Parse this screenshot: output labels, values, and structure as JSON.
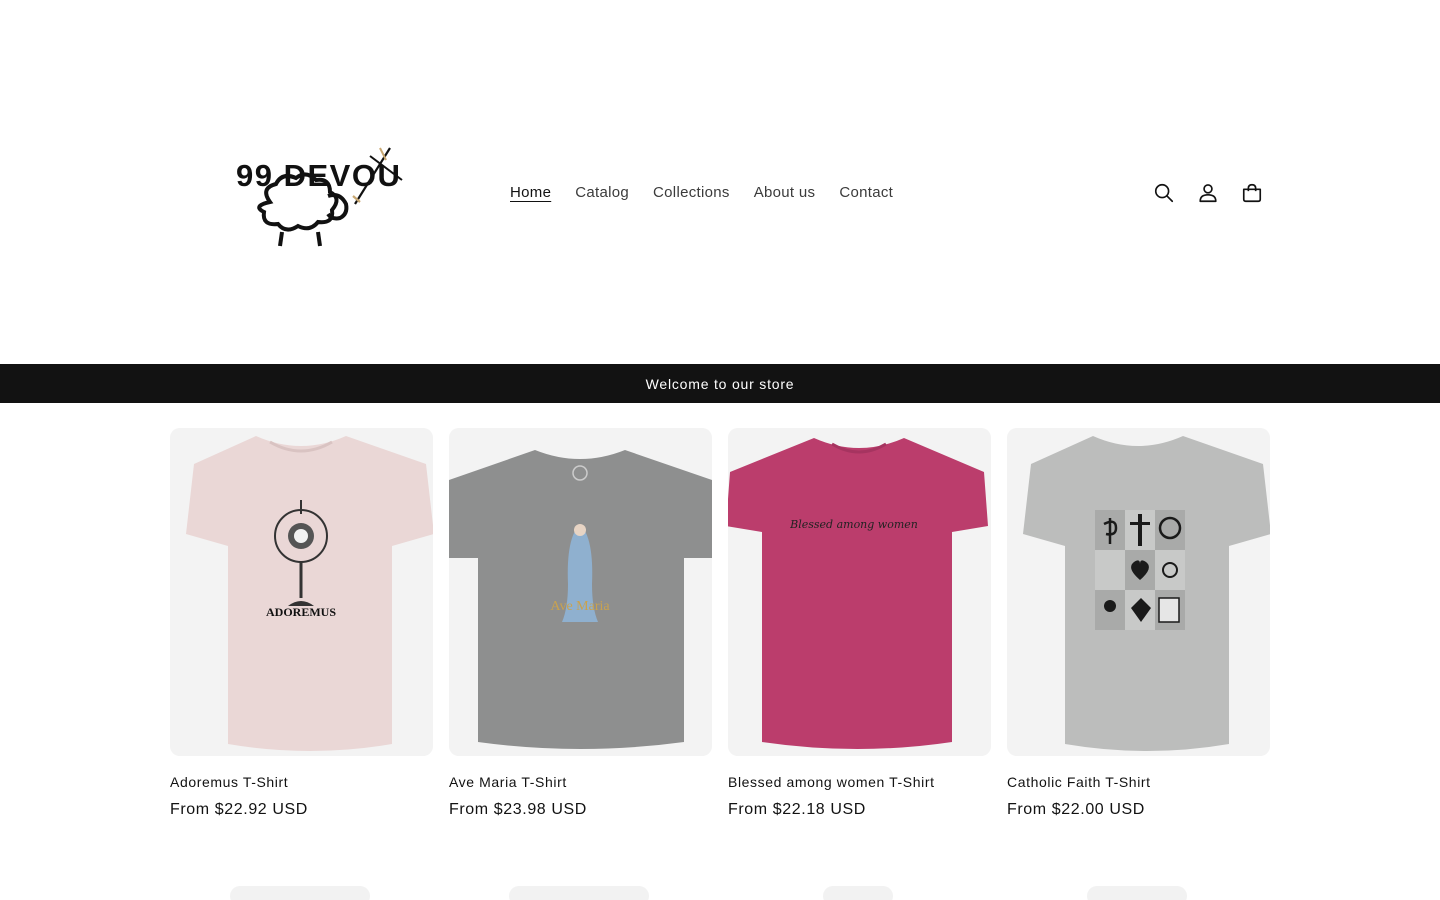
{
  "brand": {
    "logo_text": "99 DEVOU"
  },
  "nav": {
    "items": [
      {
        "label": "Home",
        "active": true
      },
      {
        "label": "Catalog"
      },
      {
        "label": "Collections"
      },
      {
        "label": "About us"
      },
      {
        "label": "Contact"
      }
    ]
  },
  "header_icons": [
    "search-icon",
    "account-icon",
    "cart-icon"
  ],
  "announcement": {
    "text": "Welcome to our store"
  },
  "products": [
    {
      "title": "Adoremus T-Shirt",
      "price": "From $22.92 USD",
      "shirt_color": "#ead7d6",
      "print_text": "ADOREMUS"
    },
    {
      "title": "Ave Maria T-Shirt",
      "price": "From $23.98 USD",
      "shirt_color": "#8e8f8f",
      "print_text": "Ave Maria"
    },
    {
      "title": "Blessed among women T-Shirt",
      "price": "From $22.18 USD",
      "shirt_color": "#bb3d6c",
      "print_text": "Blessed among women"
    },
    {
      "title": "Catholic Faith T-Shirt",
      "price": "From $22.00 USD",
      "shirt_color": "#bcbdbc",
      "print_text": ""
    }
  ],
  "colors": {
    "announcement_bg": "#121212",
    "card_bg": "#f3f3f3",
    "text": "#121212"
  }
}
